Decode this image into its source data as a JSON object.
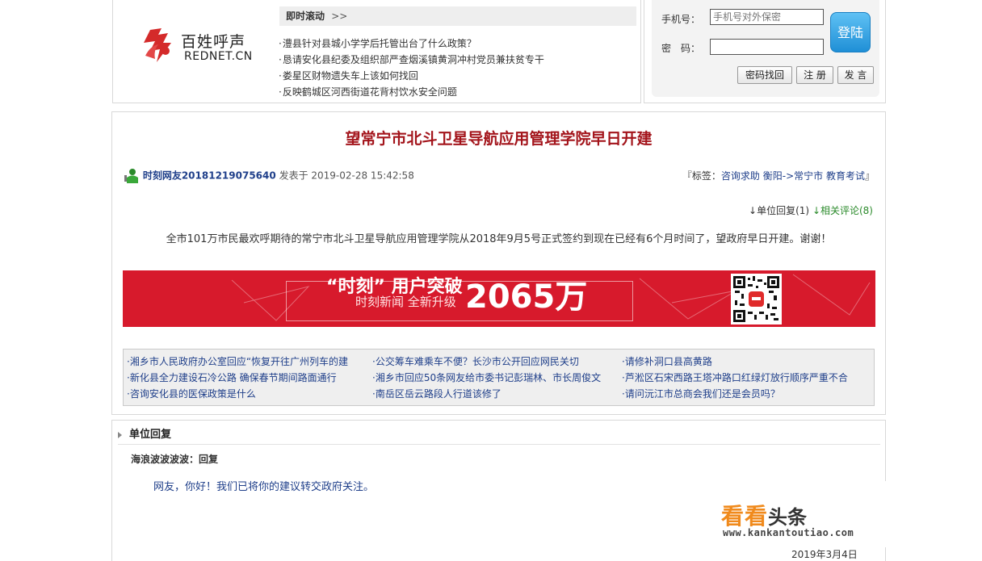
{
  "header": {
    "logo_cn": "百姓呼声",
    "logo_en": "REDNET.CN",
    "scroll_title": "即时滚动",
    "scroll_arrows": ">>",
    "scroll_items": [
      "澧县针对县城小学学后托管出台了什么政策？",
      "恳请安化县纪委及组织部严查烟溪镇黄洞冲村党员兼扶贫专干",
      "娄星区财物遗失车上该如何找回",
      "反映鹤城区河西街道花背村饮水安全问题"
    ]
  },
  "login": {
    "phone_label": "手机号：",
    "phone_placeholder": "手机号对外保密",
    "password_label": "密　码：",
    "login_button": "登陆",
    "find_password": "密码找回",
    "register": "注 册",
    "post": "发 言"
  },
  "article": {
    "title": "望常宁市北斗卫星导航应用管理学院早日开建",
    "author": "时刻网友20181219075640",
    "published": "发表于 2019-02-28 15:42:58",
    "tags_prefix": "『标签：",
    "tags": [
      "咨询求助",
      "衡阳->常宁市",
      "教育考试"
    ],
    "tags_suffix": "』",
    "unit_reply_link": "↓单位回复(1)",
    "related_comments_link": "↓相关评论(8)",
    "content": "全市101万市民最欢呼期待的常宁市北斗卫星导航应用管理学院从2018年9月5号正式签约到现在已经有6个月时间了，望政府早日开建。谢谢！"
  },
  "banner": {
    "headline": "“时刻” 用户突破",
    "subline": "时刻新闻 全新升级",
    "number": "2065万"
  },
  "related": {
    "col1": [
      "湘乡市人民政府办公室回应“恢复开往广州列车的建",
      "新化县全力建设石冷公路 确保春节期间路面通行",
      "咨询安化县的医保政策是什么"
    ],
    "col2": [
      "公交筹车难乘车不便？长沙市公开回应网民关切",
      "湘乡市回应50条网友给市委书记彭瑞林、市长周俊文",
      "南岳区岳云路段人行道该修了"
    ],
    "col3": [
      "请修补洞口县高黄路",
      "芦淞区石宋西路王塔冲路口红绿灯放行顺序严重不合",
      "请问沅江市总商会我们还是会员吗？"
    ]
  },
  "reply": {
    "section_title": "单位回复",
    "unit_name": "海浪波波波波：回复",
    "text": "网友，你好！我们已将你的建议转交政府关注。",
    "date": "2019年3月4日"
  },
  "watermark": {
    "brand_orange": "看看",
    "brand_dark": "头条",
    "url": "www.kankantoutiao.com"
  },
  "colors": {
    "title_red": "#a3141b",
    "link_blue": "#1f3f8a",
    "banner_red": "#d71a2c",
    "login_blue": "#1f8fd6",
    "comment_green": "#2a8a2a"
  }
}
